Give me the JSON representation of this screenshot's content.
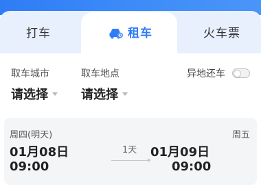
{
  "tabs": {
    "taxi": "打车",
    "rent": "租车",
    "train": "火车票"
  },
  "form": {
    "pickup_city_label": "取车城市",
    "pickup_city_value": "请选择",
    "pickup_location_label": "取车地点",
    "pickup_location_value": "请选择",
    "return_elsewhere_label": "异地还车",
    "return_elsewhere_enabled": false
  },
  "schedule": {
    "pickup_day": "周四(明天)",
    "pickup_date": "01月08日",
    "pickup_time": "09:00",
    "duration": "1天",
    "return_day": "周五",
    "return_date": "01月09日",
    "return_time": "09:00"
  },
  "colors": {
    "accent": "#2f7cf6",
    "tabbar_bg": "#e8f0fe",
    "card_bg": "#f4f5f7"
  }
}
